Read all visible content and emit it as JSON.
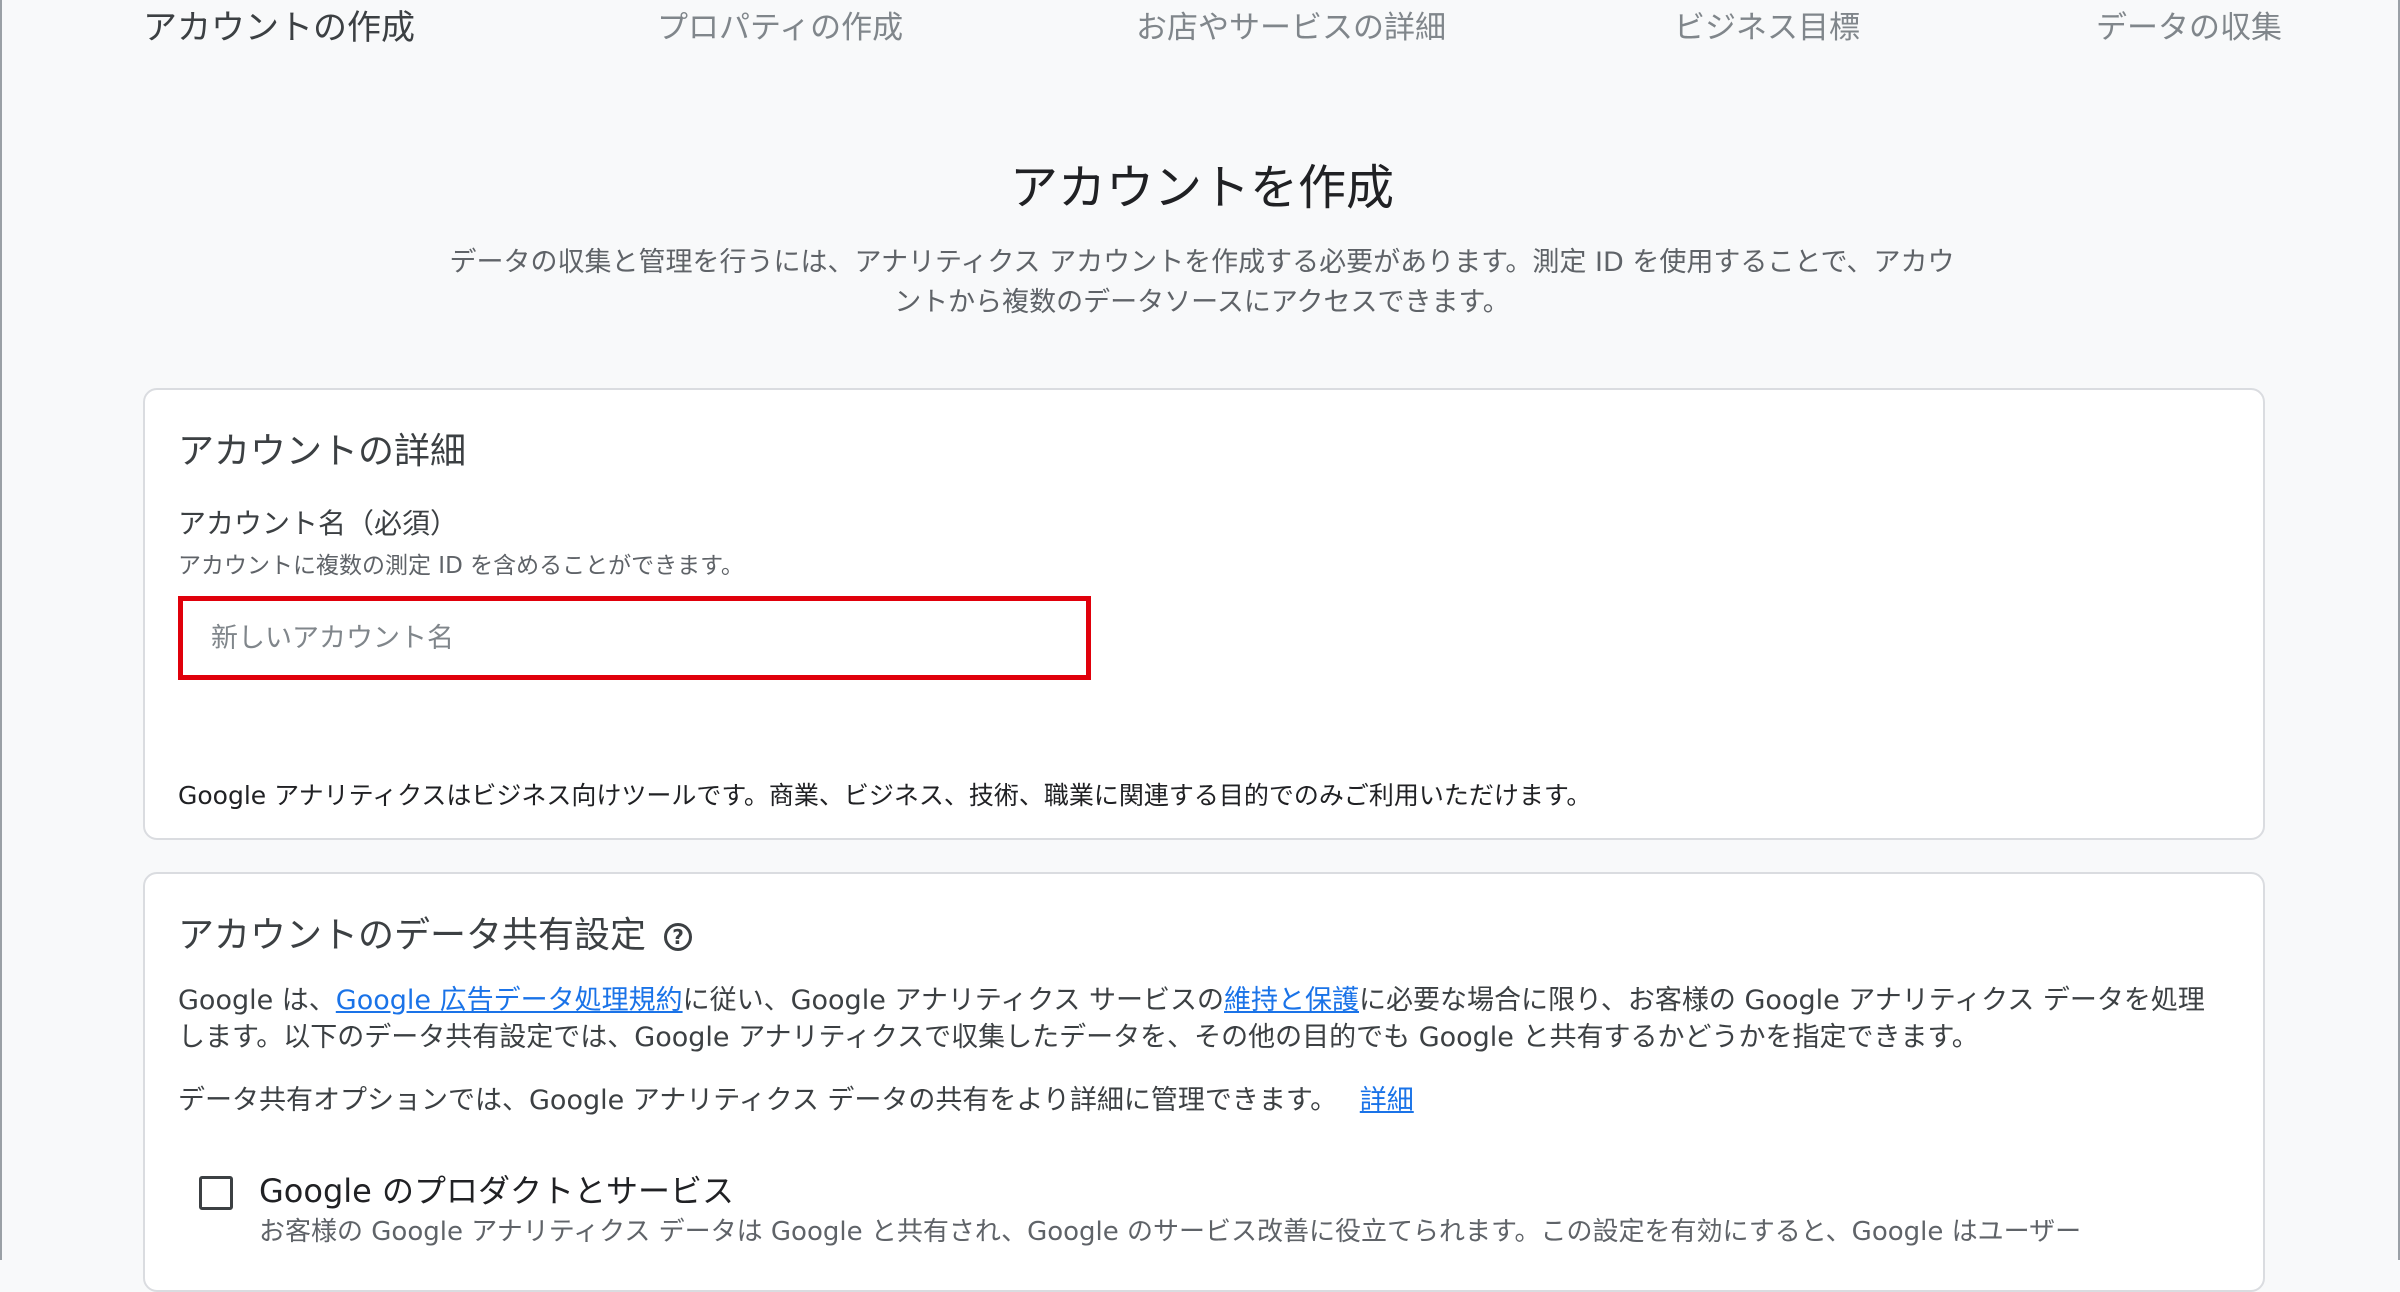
{
  "stepper": {
    "steps": [
      "アカウントの作成",
      "プロパティの作成",
      "お店やサービスの詳細",
      "ビジネス目標",
      "データの収集"
    ],
    "active_index": 0
  },
  "header": {
    "title": "アカウントを作成",
    "description_line1": "データの収集と管理を行うには、アナリティクス アカウントを作成する必要があります。測定 ID を使用することで、アカウ",
    "description_line2": "ントから複数のデータソースにアクセスできます。"
  },
  "account_details": {
    "title": "アカウントの詳細",
    "field_label": "アカウント名（必須）",
    "field_help": "アカウントに複数の測定 ID を含めることができます。",
    "input_value": "",
    "input_placeholder": "新しいアカウント名",
    "notice": "Google アナリティクスはビジネス向けツールです。商業、ビジネス、技術、職業に関連する目的でのみご利用いただけます。"
  },
  "data_sharing": {
    "title": "アカウントのデータ共有設定",
    "help_icon": "help-circle-icon",
    "para1_prefix": "Google は、",
    "para1_link1": "Google 広告データ処理規約",
    "para1_mid": "に従い、Google アナリティクス サービスの",
    "para1_link2": "維持と保護",
    "para1_suffix": "に必要な場合に限り、お客様の Google アナリティクス データを処理",
    "para1_line2": "します。以下のデータ共有設定では、Google アナリティクスで収集したデータを、その他の目的でも Google と共有するかどうかを指定できます。",
    "para2_text": "データ共有オプションでは、Google アナリティクス データの共有をより詳細に管理できます。",
    "para2_link": "詳細",
    "option1": {
      "label": "Google のプロダクトとサービス",
      "checked": false,
      "description": "お客様の Google アナリティクス データは Google と共有され、Google のサービス改善に役立てられます。この設定を有効にすると、Google はユーザー"
    }
  }
}
